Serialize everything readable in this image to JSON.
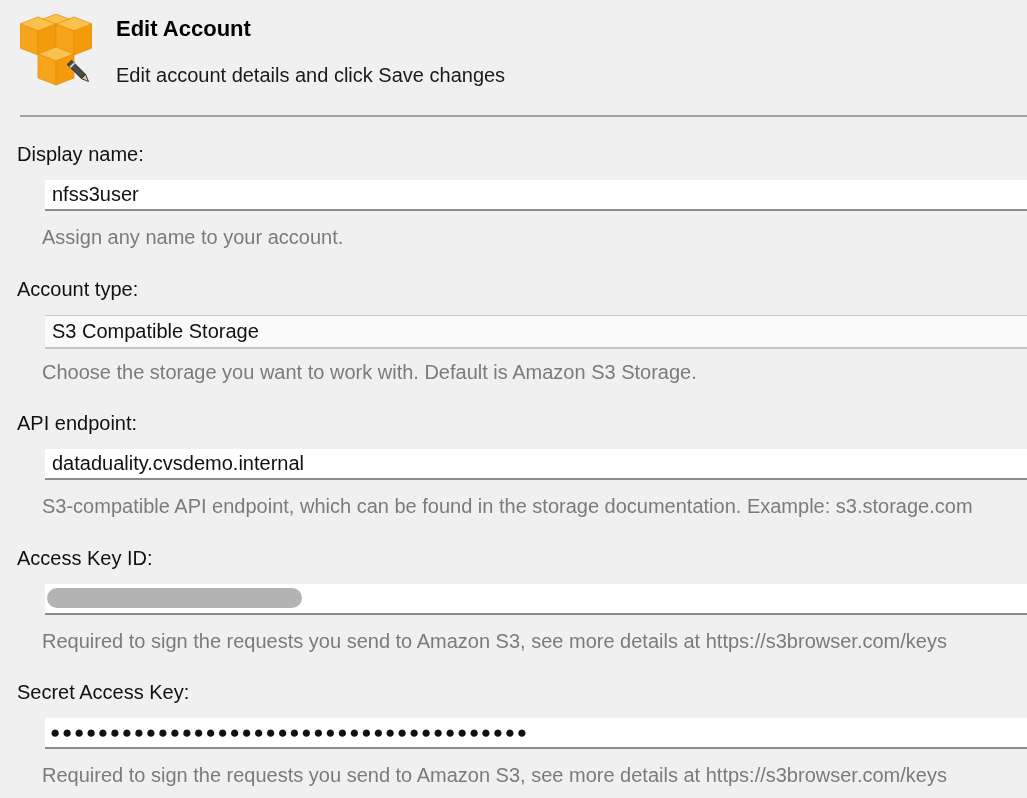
{
  "header": {
    "title": "Edit Account",
    "subtitle": "Edit account details and click Save changes"
  },
  "fields": [
    {
      "label": "Display name:",
      "kind": "text",
      "value": "nfss3user",
      "hint": "Assign any name to your account."
    },
    {
      "label": "Account type:",
      "kind": "select",
      "value": "S3 Compatible Storage",
      "hint": "Choose the storage you want to work with. Default is Amazon S3 Storage."
    },
    {
      "label": "API endpoint:",
      "kind": "text",
      "value": "dataduality.cvsdemo.internal",
      "hint": "S3-compatible API endpoint, which can be found in the storage documentation. Example: s3.storage.com"
    },
    {
      "label": "Access Key ID:",
      "kind": "redacted",
      "hint": "Required to sign the requests you send to Amazon S3, see more details at https://s3browser.com/keys"
    },
    {
      "label": "Secret Access Key:",
      "kind": "password",
      "value": "●●●●●●●●●●●●●●●●●●●●●●●●●●●●●●●●●●●●●●●●",
      "hint": "Required to sign the requests you send to Amazon S3, see more details at https://s3browser.com/keys"
    }
  ]
}
